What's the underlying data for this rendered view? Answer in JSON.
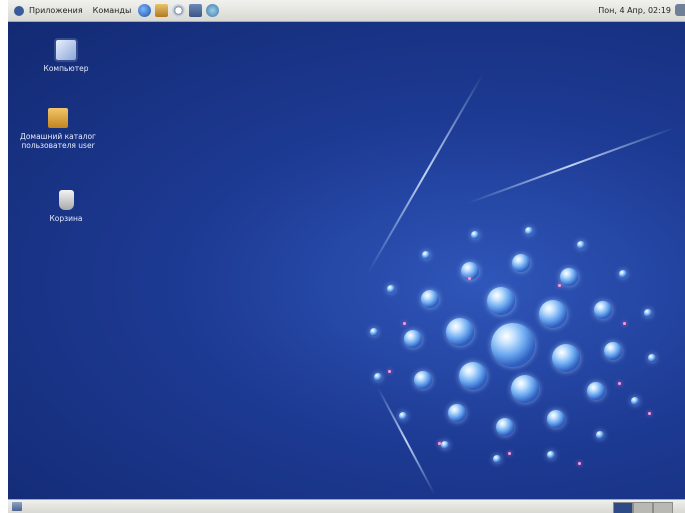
{
  "top_panel": {
    "menus": [
      "Приложения",
      "Команды"
    ],
    "clock": "Пон, 4 Апр, 02:19"
  },
  "desktop": {
    "icons": [
      {
        "label": "Компьютер"
      },
      {
        "label": "Домашний каталог пользователя user"
      },
      {
        "label": "Корзина"
      }
    ]
  },
  "colors": {
    "desktop_bg": "#1d3a93",
    "panel_bg": "#e6e6e1"
  }
}
